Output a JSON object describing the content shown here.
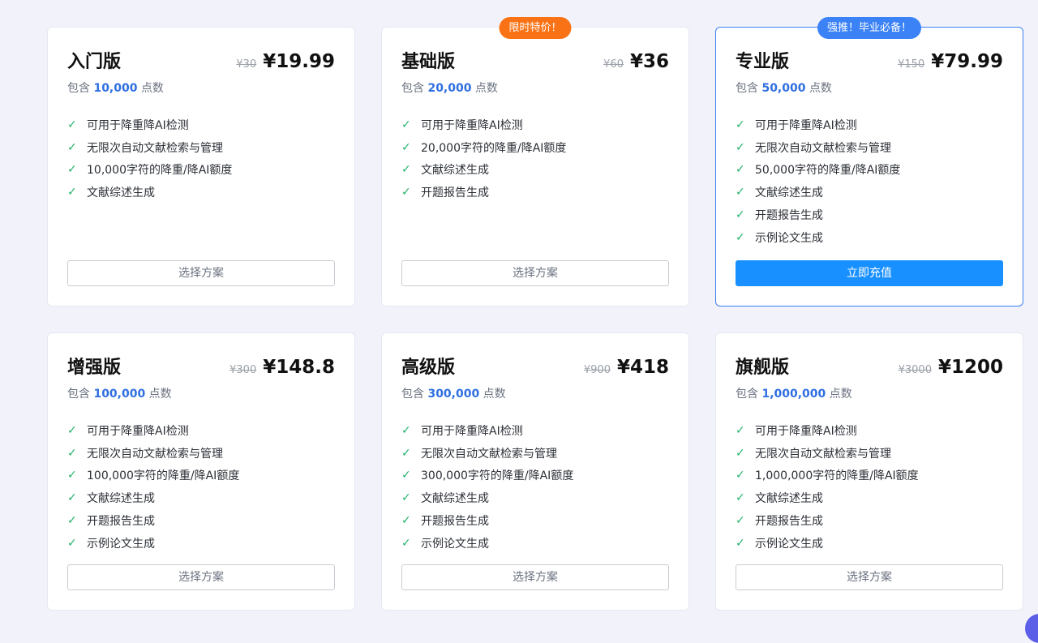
{
  "plans": [
    {
      "title": "入门版",
      "old_price": "¥30",
      "price": "¥19.99",
      "points_prefix": "包含",
      "points": "10,000",
      "points_suffix": "点数",
      "badge": "",
      "featured": false,
      "button": "选择方案",
      "features": [
        "可用于降重降AI检测",
        "无限次自动文献检索与管理",
        "10,000字符的降重/降AI额度",
        "文献综述生成"
      ]
    },
    {
      "title": "基础版",
      "old_price": "¥60",
      "price": "¥36",
      "points_prefix": "包含",
      "points": "20,000",
      "points_suffix": "点数",
      "badge": "限时特价！",
      "badge_color": "#f97316",
      "featured": false,
      "button": "选择方案",
      "features": [
        "可用于降重降AI检测",
        "20,000字符的降重/降AI额度",
        "文献综述生成",
        "开题报告生成"
      ]
    },
    {
      "title": "专业版",
      "old_price": "¥150",
      "price": "¥79.99",
      "points_prefix": "包含",
      "points": "50,000",
      "points_suffix": "点数",
      "badge": "强推！毕业必备！",
      "badge_color": "#3b82f6",
      "featured": true,
      "button": "立即充值",
      "features": [
        "可用于降重降AI检测",
        "无限次自动文献检索与管理",
        "50,000字符的降重/降AI额度",
        "文献综述生成",
        "开题报告生成",
        "示例论文生成"
      ]
    },
    {
      "title": "增强版",
      "old_price": "¥300",
      "price": "¥148.8",
      "points_prefix": "包含",
      "points": "100,000",
      "points_suffix": "点数",
      "badge": "",
      "featured": false,
      "button": "选择方案",
      "features": [
        "可用于降重降AI检测",
        "无限次自动文献检索与管理",
        "100,000字符的降重/降AI额度",
        "文献综述生成",
        "开题报告生成",
        "示例论文生成"
      ]
    },
    {
      "title": "高级版",
      "old_price": "¥900",
      "price": "¥418",
      "points_prefix": "包含",
      "points": "300,000",
      "points_suffix": "点数",
      "badge": "",
      "featured": false,
      "button": "选择方案",
      "features": [
        "可用于降重降AI检测",
        "无限次自动文献检索与管理",
        "300,000字符的降重/降AI额度",
        "文献综述生成",
        "开题报告生成",
        "示例论文生成"
      ]
    },
    {
      "title": "旗舰版",
      "old_price": "¥3000",
      "price": "¥1200",
      "points_prefix": "包含",
      "points": "1,000,000",
      "points_suffix": "点数",
      "badge": "",
      "featured": false,
      "button": "选择方案",
      "features": [
        "可用于降重降AI检测",
        "无限次自动文献检索与管理",
        "1,000,000字符的降重/降AI额度",
        "文献综述生成",
        "开题报告生成",
        "示例论文生成"
      ]
    }
  ],
  "icons": {
    "feature_check": "check-icon"
  },
  "colors": {
    "accent": "#1890ff",
    "points_number": "#2f6fe0",
    "check": "#22b36b"
  }
}
